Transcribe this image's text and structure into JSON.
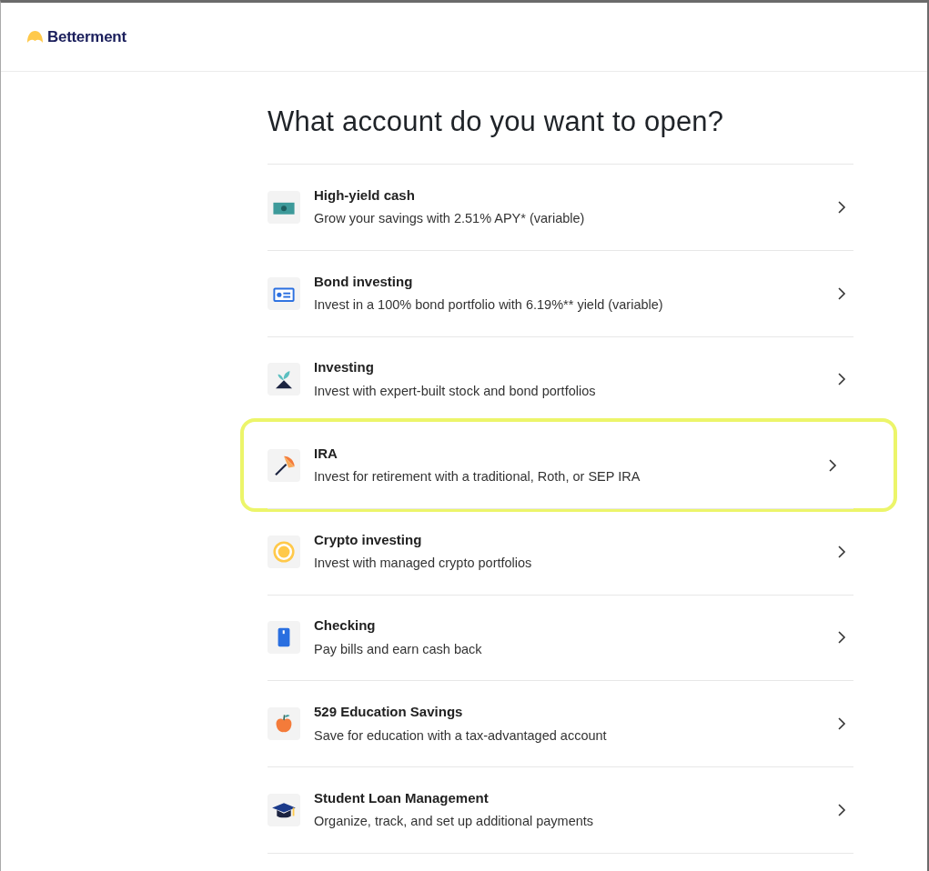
{
  "header": {
    "brand": "Betterment"
  },
  "heading": "What account do you want to open?",
  "accounts": [
    {
      "kind": "cash",
      "title": "High-yield cash",
      "description": "Grow your savings with 2.51% APY* (variable)",
      "highlighted": false
    },
    {
      "kind": "bond",
      "title": "Bond investing",
      "description": "Invest in a 100% bond portfolio with 6.19%** yield (variable)",
      "highlighted": false
    },
    {
      "kind": "sprout",
      "title": "Investing",
      "description": "Invest with expert-built stock and bond portfolios",
      "highlighted": false
    },
    {
      "kind": "umbrella",
      "title": "IRA",
      "description": "Invest for retirement with a traditional, Roth, or SEP IRA",
      "highlighted": true
    },
    {
      "kind": "coin",
      "title": "Crypto investing",
      "description": "Invest with managed crypto portfolios",
      "highlighted": false
    },
    {
      "kind": "card",
      "title": "Checking",
      "description": "Pay bills and earn cash back",
      "highlighted": false
    },
    {
      "kind": "apple",
      "title": "529 Education Savings",
      "description": "Save for education with a tax-advantaged account",
      "highlighted": false
    },
    {
      "kind": "cap",
      "title": "Student Loan Management",
      "description": "Organize, track, and set up additional payments",
      "highlighted": false
    }
  ]
}
